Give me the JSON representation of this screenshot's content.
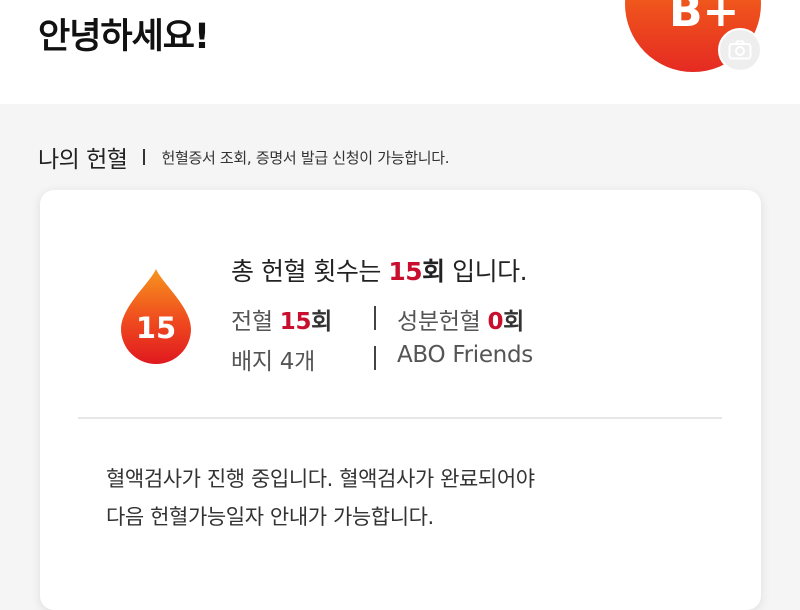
{
  "header": {
    "greeting": "안녕하세요!",
    "blood_type": "B+",
    "camera_icon": "camera-icon"
  },
  "section": {
    "title": "나의 헌혈",
    "subtitle": "헌혈증서 조회, 증명서 발급 신청이 가능합니다."
  },
  "summary": {
    "drop_count": "15",
    "prefix": "총 헌혈 횟수는 ",
    "count": "15",
    "unit": "회",
    "suffix": " 입니다.",
    "whole_blood_label": "전혈 ",
    "whole_blood_count": "15",
    "whole_blood_unit": "회",
    "apheresis_label": "성분헌혈 ",
    "apheresis_count": "0",
    "apheresis_unit": "회",
    "badge": "배지 4개",
    "group": "ABO Friends"
  },
  "notice": {
    "line1": "혈액검사가 진행 중입니다. 혈액검사가 완료되어야",
    "line2": "다음 헌혈가능일자 안내가 가능합니다."
  },
  "colors": {
    "accent_red": "#c8102e",
    "avatar_top": "#f58a14",
    "avatar_bottom": "#e52a22"
  }
}
